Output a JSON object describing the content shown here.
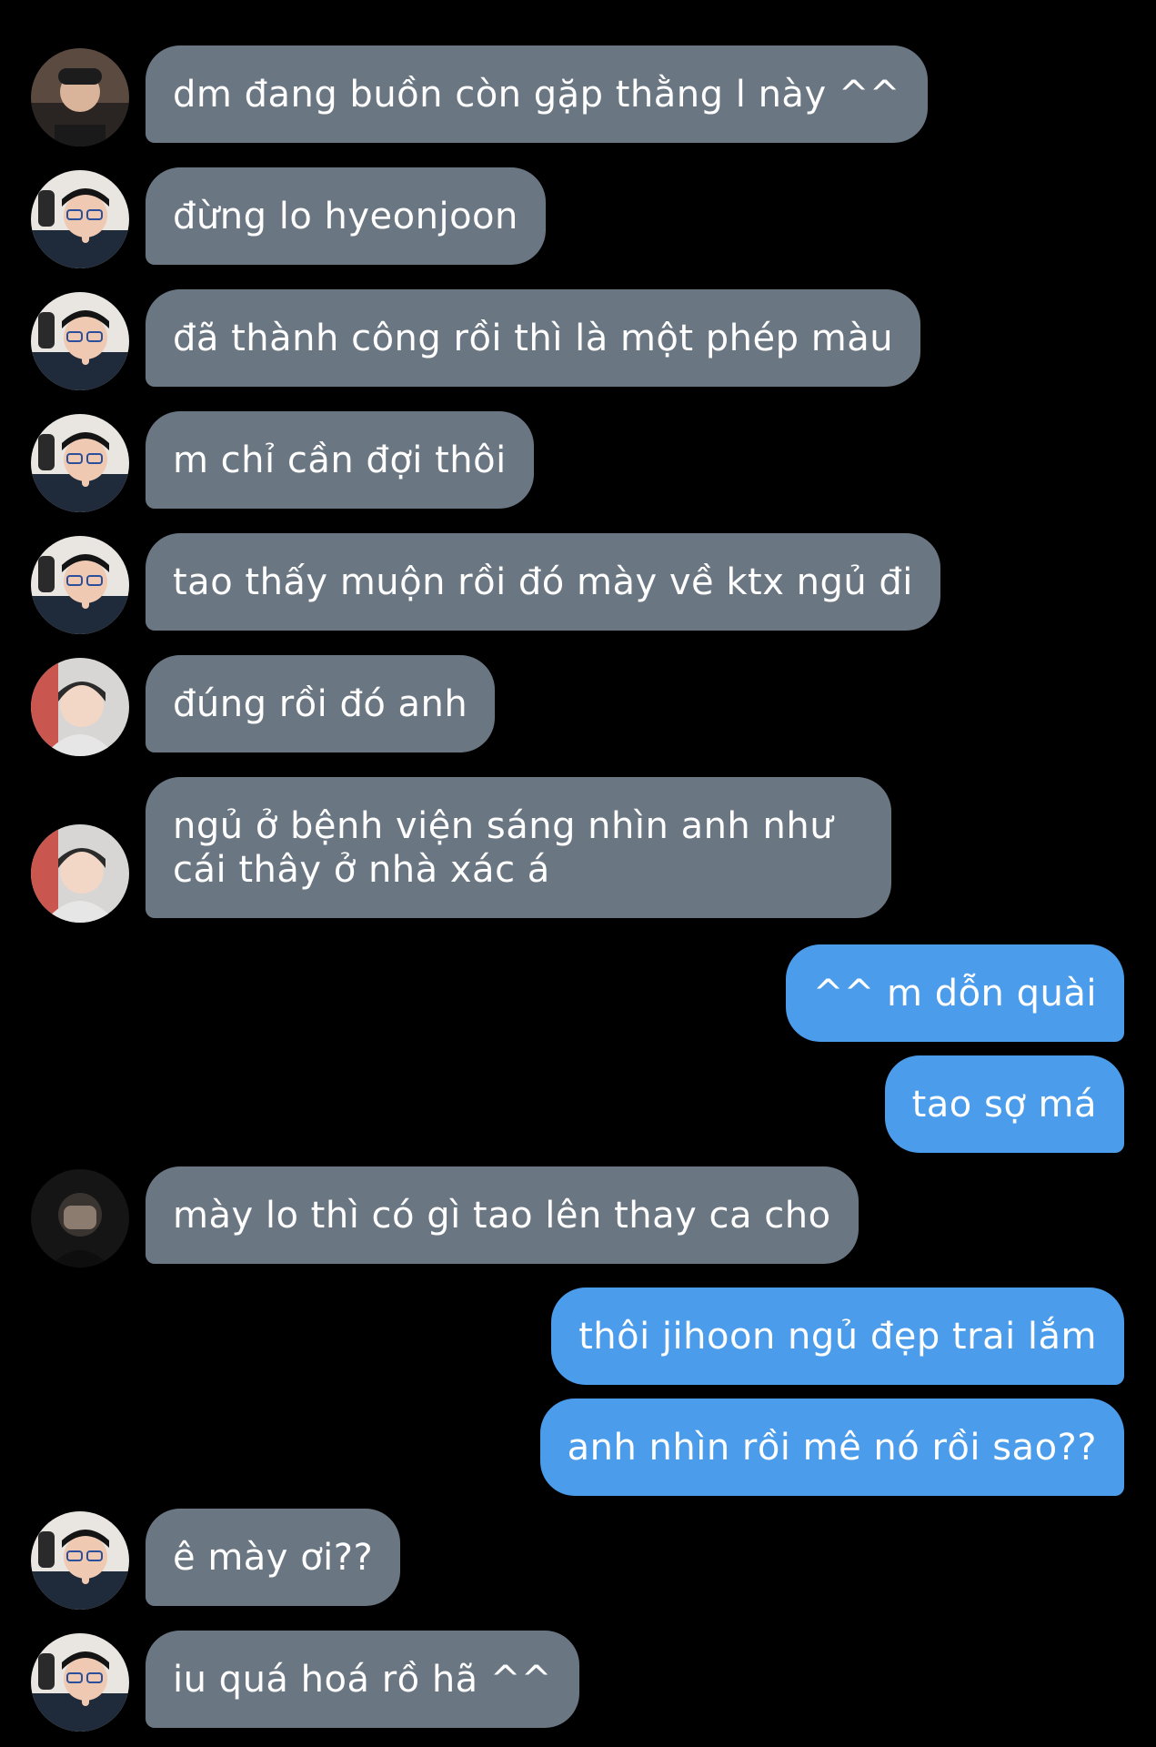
{
  "conversation": {
    "messages": [
      {
        "sender": "other",
        "avatar": "user-avatar-hat",
        "text": "dm đang buồn còn gặp thằng l này ^^"
      },
      {
        "sender": "other",
        "avatar": "user-avatar-glasses",
        "text": "đừng lo hyeonjoon"
      },
      {
        "sender": "other",
        "avatar": "user-avatar-glasses",
        "text": "đã thành công rồi thì là một phép màu"
      },
      {
        "sender": "other",
        "avatar": "user-avatar-glasses",
        "text": "m chỉ cần đợi thôi"
      },
      {
        "sender": "other",
        "avatar": "user-avatar-glasses",
        "text": "tao thấy muộn rồi đó mày về ktx ngủ đi"
      },
      {
        "sender": "other",
        "avatar": "user-avatar-hoodie",
        "text": "đúng rồi đó anh"
      },
      {
        "sender": "other",
        "avatar": "user-avatar-hoodie",
        "text": "ngủ ở bệnh viện sáng nhìn anh như cái thây ở nhà xác á"
      },
      {
        "sender": "me",
        "text": "^^ m dỗn quài"
      },
      {
        "sender": "me",
        "text": "tao sợ má"
      },
      {
        "sender": "other",
        "avatar": "user-avatar-dark",
        "text": "mày lo thì có gì tao lên thay ca cho"
      },
      {
        "sender": "me",
        "text": "thôi jihoon ngủ đẹp trai lắm"
      },
      {
        "sender": "me",
        "text": "anh nhìn rồi mê nó rồi sao??"
      },
      {
        "sender": "other",
        "avatar": "user-avatar-glasses",
        "text": "ê mày ơi??"
      },
      {
        "sender": "other",
        "avatar": "user-avatar-glasses",
        "text": "iu quá hoá rồ hã ^^"
      }
    ]
  },
  "colors": {
    "background": "#000000",
    "incoming_bubble": "#6a7682",
    "outgoing_bubble": "#4c9cec",
    "text": "#ffffff"
  }
}
